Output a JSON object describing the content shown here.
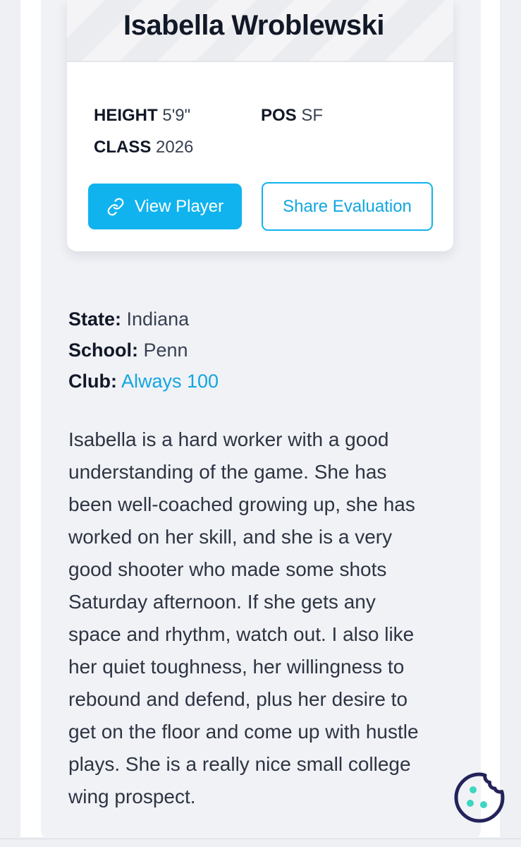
{
  "player": {
    "name": "Isabella Wroblewski",
    "height_label": "HEIGHT",
    "height_value": "5'9\"",
    "pos_label": "POS",
    "pos_value": "SF",
    "class_label": "CLASS",
    "class_value": "2026"
  },
  "buttons": {
    "view_player": "View Player",
    "share_evaluation": "Share Evaluation"
  },
  "details": {
    "state_label": "State:",
    "state_value": "Indiana",
    "school_label": "School:",
    "school_value": "Penn",
    "club_label": "Club:",
    "club_value": "Always 100"
  },
  "evaluation": {
    "lines": [
      "Isabella is a hard worker with a good",
      "understanding of the game. She has",
      "been well-coached growing up, she has",
      "worked on her skill, and she is a very",
      "good shooter who made some shots",
      "Saturday afternoon. If she gets any",
      "space and rhythm, watch out. I also like",
      "her quiet toughness, her willingness to",
      "rebound and defend, plus her desire to",
      "get on the floor and come up with hustle",
      "plays. She is a really nice small college",
      "wing prospect."
    ]
  },
  "icons": {
    "view_player_icon": "link-icon",
    "cookie_icon": "cookie-icon"
  },
  "colors": {
    "accent": "#10b3ee",
    "link": "#10a6e0",
    "cookie": "#24235a",
    "cookie_dots": "#3dd6c0"
  }
}
